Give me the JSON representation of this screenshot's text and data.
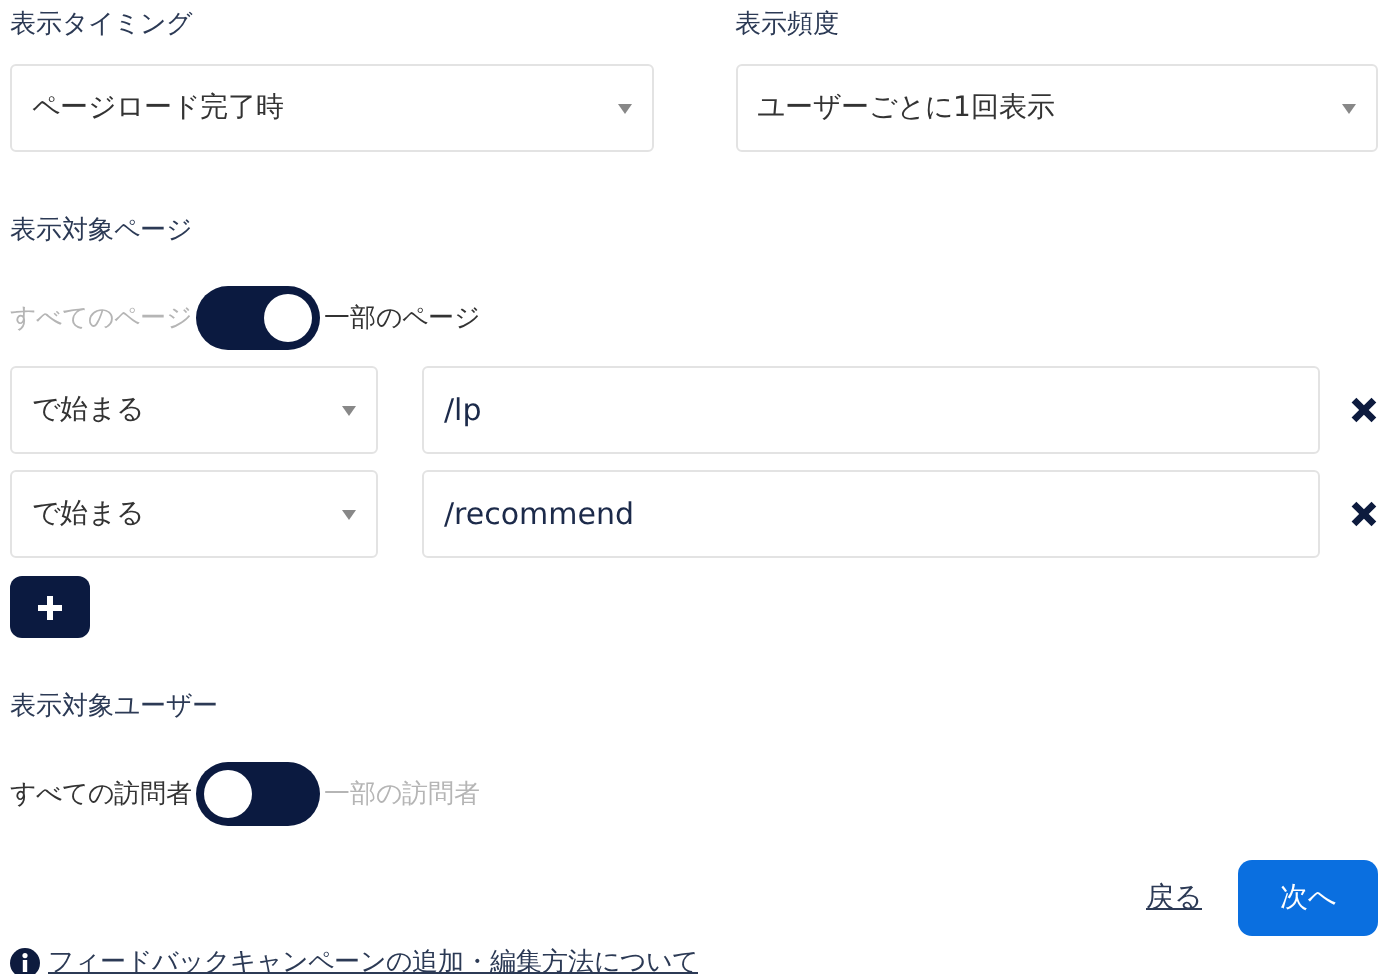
{
  "timing": {
    "label": "表示タイミング",
    "value": "ページロード完了時"
  },
  "frequency": {
    "label": "表示頻度",
    "value": "ユーザーごとに1回表示"
  },
  "target_pages": {
    "label": "表示対象ページ",
    "toggle": {
      "off_label": "すべてのページ",
      "on_label": "一部のページ",
      "on": true
    },
    "rules": [
      {
        "match": "で始まる",
        "path": "/lp"
      },
      {
        "match": "で始まる",
        "path": "/recommend"
      }
    ]
  },
  "target_users": {
    "label": "表示対象ユーザー",
    "toggle": {
      "off_label": "すべての訪問者",
      "on_label": "一部の訪問者",
      "on": false
    }
  },
  "back_link": "戻る",
  "next_button": "次へ",
  "help_link": "フィードバックキャンペーンの追加・編集方法について"
}
